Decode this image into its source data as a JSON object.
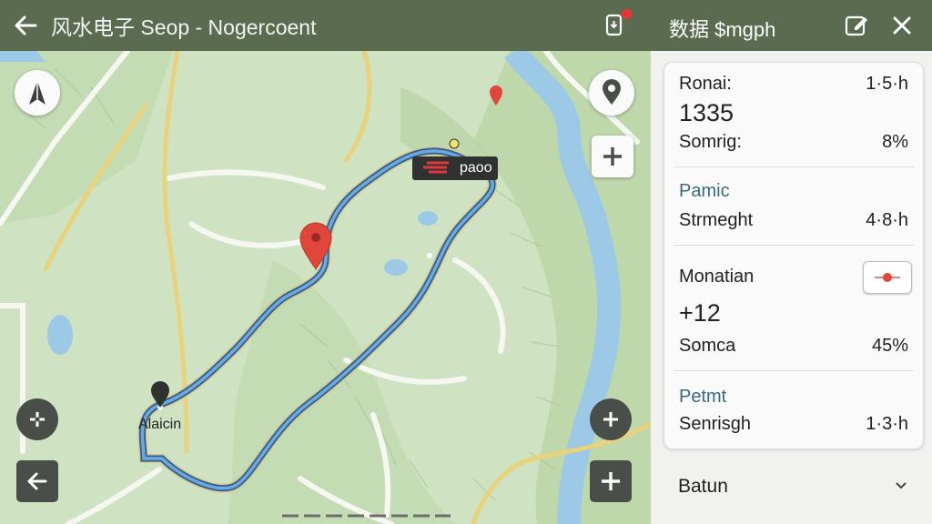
{
  "header": {
    "title": "风水电子 Seop - Nogercoent",
    "back_icon": "arrow-left-icon",
    "share_icon": "phone-share-icon"
  },
  "panel": {
    "title": "数据 $mgph",
    "edit_icon": "edit-icon",
    "close_icon": "close-icon",
    "rows": {
      "r1_label": "Ronai:",
      "r1_value": "1·5·h",
      "r1_big": "1335",
      "r2_label": "Somrig:",
      "r2_value": "8%",
      "sec2_title": "Pamic",
      "r3_label": "Strmeght",
      "r3_value": "4·8·h",
      "sec3_title": "Monatian",
      "sec3_big": "+12",
      "r4_label": "Somca",
      "r4_value": "45%",
      "sec4_title": "Petmt",
      "r5_label": "Senrisgh",
      "r5_value": "1·3·h"
    },
    "footer_label": "Batun"
  },
  "map": {
    "tag_label": "paoo",
    "start_label": "Alaicin"
  },
  "colors": {
    "header_bg": "#5a6b50",
    "map_bg": "#cfe3c2",
    "route": "#4f8fc9",
    "pin": "#e0463a",
    "water": "#9cc9e6"
  }
}
